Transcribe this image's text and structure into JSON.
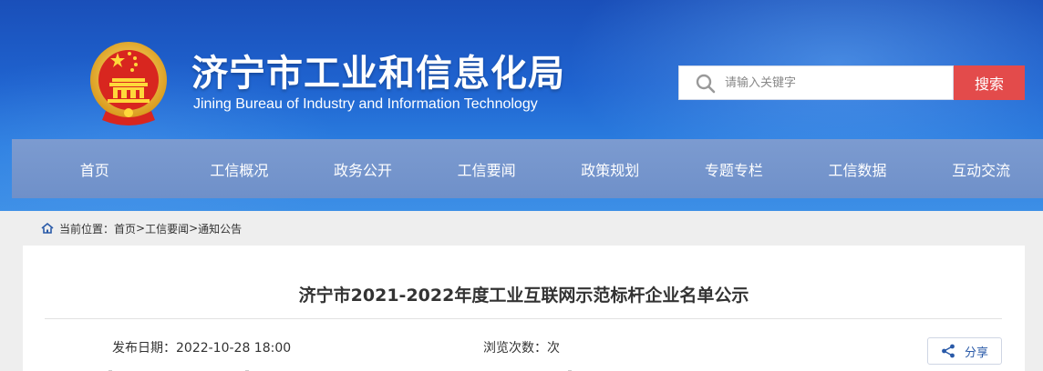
{
  "header": {
    "title_cn": "济宁市工业和信息化局",
    "title_en": "Jining Bureau of Industry and Information Technology",
    "emblem_icon": "national-emblem-icon",
    "colors": {
      "primary": "#1f63cf",
      "accent": "#e34b4b"
    }
  },
  "search": {
    "placeholder": "请输入关键字",
    "value": "",
    "button_label": "搜索",
    "icon": "search-icon"
  },
  "nav": {
    "items": [
      {
        "label": "首页"
      },
      {
        "label": "工信概况"
      },
      {
        "label": "政务公开"
      },
      {
        "label": "工信要闻"
      },
      {
        "label": "政策规划"
      },
      {
        "label": "专题专栏"
      },
      {
        "label": "工信数据"
      },
      {
        "label": "互动交流"
      }
    ]
  },
  "breadcrumb": {
    "icon": "home-icon",
    "prefix": "当前位置：",
    "items": [
      {
        "label": "首页"
      },
      {
        "label": "工信要闻"
      },
      {
        "label": "通知公告"
      }
    ],
    "separator": ">"
  },
  "article": {
    "title": "济宁市2021-2022年度工业互联网示范标杆企业名单公示",
    "date_label": "发布日期：",
    "date_value": "2022-10-28 18:00",
    "views_label": "浏览次数：",
    "views_unit": "次",
    "share_label": "分享",
    "share_icon": "share-icon"
  }
}
